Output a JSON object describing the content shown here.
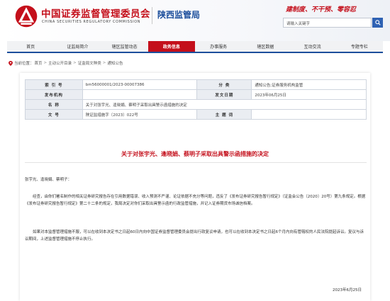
{
  "header": {
    "org_cn": "中国证券监督管理委员会",
    "org_en": "CHINA SECURITIES REGULATORY COMMISSION",
    "bureau": "陕西监管局",
    "slogan": "建制度、不干预、零容忍",
    "search_placeholder": "请输入关键字",
    "brand_color": "#c40f1b",
    "accent_color": "#1d4f9c"
  },
  "nav": {
    "items": [
      "首页",
      "证监局简介",
      "辖区监管动态",
      "政务信息",
      "办事服务",
      "辖区数据",
      "互动交流",
      "专题专栏"
    ],
    "active": "政务信息"
  },
  "breadcrumb": {
    "prefix": "当前位置：",
    "items": [
      "首页",
      "主动公开目录",
      "证监局文种类",
      "通知公告"
    ]
  },
  "meta": {
    "index_label": "索 引 号",
    "index_value": "bm56000001/2023-00007386",
    "category_label": "分 类",
    "category_value": "通知公告;证券服务机构监管",
    "issuer_label": "发布机构",
    "issuer_value": "",
    "date_label": "发文日期",
    "date_value": "2023年06月25日",
    "name_label": "名 称",
    "name_value": "关于对张宇光、逢晓娟、蔡明子采取出具警示函措施的决定",
    "docno_label": "文 号",
    "docno_value": "陕证监措施字〔2023〕022号",
    "subject_label": "主 题 词",
    "subject_value": ""
  },
  "doc": {
    "title": "关于对张宇光、逢晓娟、蔡明子采取出具警示函措施的决定",
    "salutation": "张宇光、逢晓娟、蔡明子：",
    "para1": "经查，由你们署名制作的相关证券研究报告存在引用数据错误、收入预测不严谨、论证依据不充分等问题，违反了《发布证券研究报告暂行规定》（证监会公告〔2020〕20号）第九条规定。根据《发布证券研究报告暂行规定》第二十二条的规定，我局决定对你们采取出具警示函的行政监管措施，并记入证券期货市场诚信档案。",
    "para2": "如果对本监督管理措施不服，可以在收到本决定书之日起60日内向中国证券监督管理委员会提出行政复议申请，也可以在收到本决定书之日起6个月内向有管辖权的人民法院提起诉讼。复议与诉讼期间，上述监督管理措施不停止执行。",
    "date": "2023年6月25日"
  }
}
